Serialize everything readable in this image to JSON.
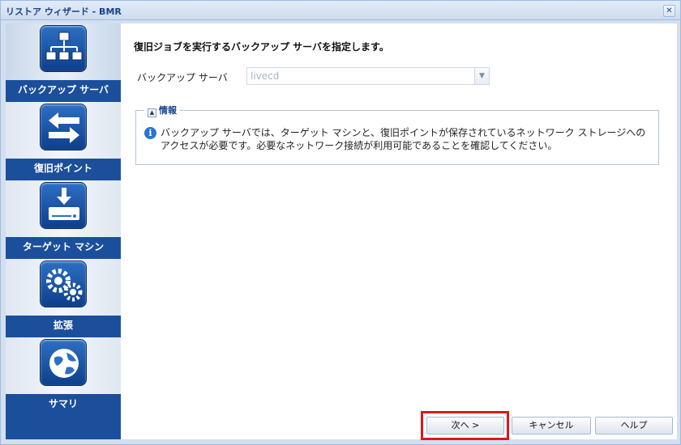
{
  "window": {
    "title": "リストア ウィザード - BMR",
    "close_glyph": "✕"
  },
  "sidebar": {
    "items": [
      {
        "label": "バックアップ サーバ",
        "icon": "server-tree-icon"
      },
      {
        "label": "復旧ポイント",
        "icon": "arrows-exchange-icon"
      },
      {
        "label": "ターゲット マシン",
        "icon": "drive-download-icon"
      },
      {
        "label": "拡張",
        "icon": "gears-icon"
      },
      {
        "label": "サマリ",
        "icon": "globe-icon"
      }
    ]
  },
  "main": {
    "heading": "復旧ジョブを実行するバックアップ サーバを指定します。",
    "server_field": {
      "label": "バックアップ サーバ",
      "value": "livecd",
      "trigger_glyph": "▼"
    },
    "info": {
      "legend": "情報",
      "toggle_glyph": "▲",
      "icon_glyph": "i",
      "text": "バックアップ サーバでは、ターゲット マシンと、復旧ポイントが保存されているネットワーク ストレージへのアクセスが必要です。必要なネットワーク接続が利用可能であることを確認してください。"
    }
  },
  "footer": {
    "next_label": "次へ >",
    "cancel_label": "キャンセル",
    "help_label": "ヘルプ"
  },
  "colors": {
    "sidebar_blue": "#1b4f9c",
    "highlight_red": "#e0161b",
    "title_blue": "#15428b"
  }
}
